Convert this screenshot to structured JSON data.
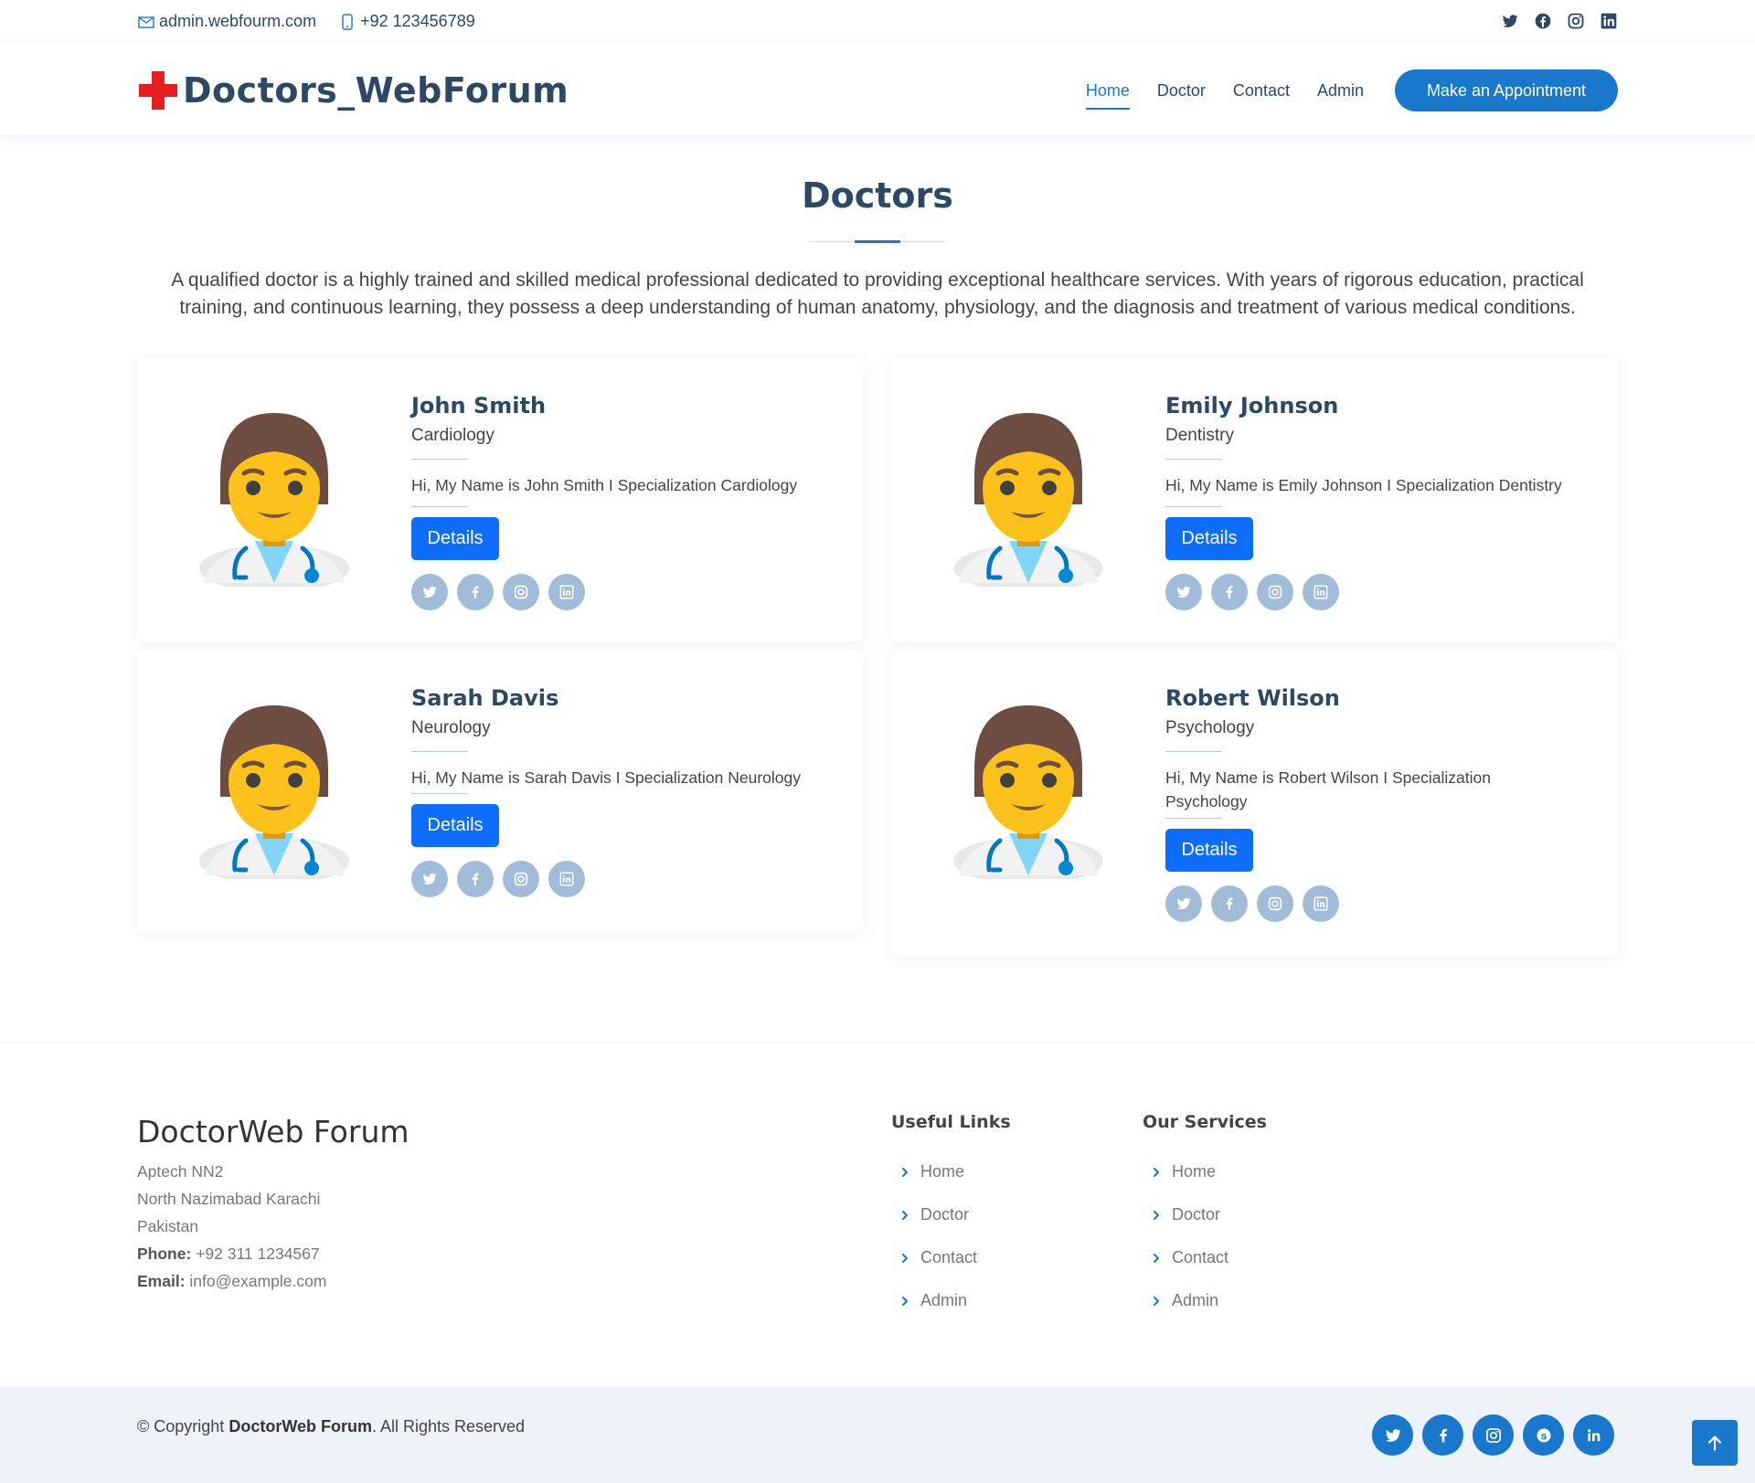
{
  "topbar": {
    "email": "admin.webfourm.com",
    "phone": "+92 123456789",
    "social": [
      "twitter-icon",
      "facebook-icon",
      "instagram-icon",
      "linkedin-icon"
    ]
  },
  "header": {
    "logo_text": "Doctors_WebForum",
    "nav": [
      "Home",
      "Doctor",
      "Contact",
      "Admin"
    ],
    "active_nav": "Home",
    "cta": "Make an Appointment"
  },
  "section": {
    "title": "Doctors",
    "description": "A qualified doctor is a highly trained and skilled medical professional dedicated to providing exceptional healthcare services. With years of rigorous education, practical training, and continuous learning, they possess a deep understanding of human anatomy, physiology, and the diagnosis and treatment of various medical conditions."
  },
  "doctors": [
    {
      "name": "John Smith",
      "specialization": "Cardiology",
      "bio": "Hi, My Name is John Smith I Specialization Cardiology",
      "button": "Details"
    },
    {
      "name": "Emily Johnson",
      "specialization": "Dentistry",
      "bio": "Hi, My Name is Emily Johnson I Specialization Dentistry",
      "button": "Details"
    },
    {
      "name": "Sarah Davis",
      "specialization": "Neurology",
      "bio": "Hi, My Name is Sarah Davis I Specialization Neurology",
      "button": "Details"
    },
    {
      "name": "Robert Wilson",
      "specialization": "Psychology",
      "bio": "Hi, My Name is Robert Wilson I Specialization Psychology",
      "button": "Details"
    }
  ],
  "footer": {
    "brand": "DoctorWeb Forum",
    "address_line1": "Aptech NN2",
    "address_line2": "North Nazimabad Karachi",
    "address_line3": "Pakistan",
    "phone_label": "Phone:",
    "phone": "+92 311 1234567",
    "email_label": "Email:",
    "email": "info@example.com",
    "useful_links_title": "Useful Links",
    "useful_links": [
      "Home",
      "Doctor",
      "Contact",
      "Admin"
    ],
    "services_title": "Our Services",
    "services": [
      "Home",
      "Doctor",
      "Contact",
      "Admin"
    ],
    "copyright_prefix": "© Copyright",
    "copyright_brand": "DoctorWeb Forum",
    "copyright_suffix": ". All Rights Reserved",
    "social": [
      "twitter-icon",
      "facebook-icon",
      "instagram-icon",
      "skype-icon",
      "linkedin-icon"
    ]
  },
  "colors": {
    "primary": "#1977cc",
    "heading": "#2c4964",
    "button": "#0d6efd",
    "social_circle": "#a0bcd8",
    "logo_cross": "#e61e1e"
  }
}
